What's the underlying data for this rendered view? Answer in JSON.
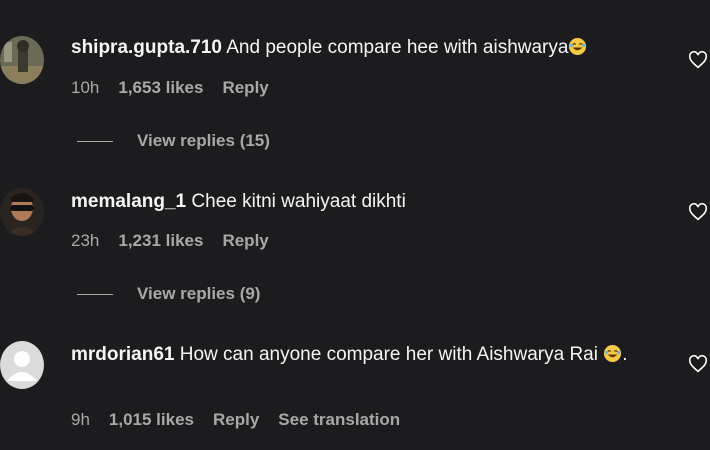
{
  "comments": [
    {
      "username": "shipra.gupta.710",
      "text": "And people compare hee with aishwarya",
      "emoji": "laughing-emoji",
      "time": "10h",
      "likes": "1,653 likes",
      "reply_label": "Reply",
      "view_replies": "View replies (15)"
    },
    {
      "username": "memalang_1",
      "text": "Chee kitni wahiyaat dikhti",
      "time": "23h",
      "likes": "1,231 likes",
      "reply_label": "Reply",
      "view_replies": "View replies (9)"
    },
    {
      "username": "mrdorian61",
      "text": "How can anyone compare her with Aishwarya Rai",
      "text_suffix": ".",
      "emoji": "laughing-emoji",
      "time": "9h",
      "likes": "1,015 likes",
      "reply_label": "Reply",
      "translation_label": "See translation"
    }
  ],
  "colors": {
    "background": "#1c1c1e",
    "primary_text": "#f5f5f5",
    "secondary_text": "#a8a8a8"
  }
}
